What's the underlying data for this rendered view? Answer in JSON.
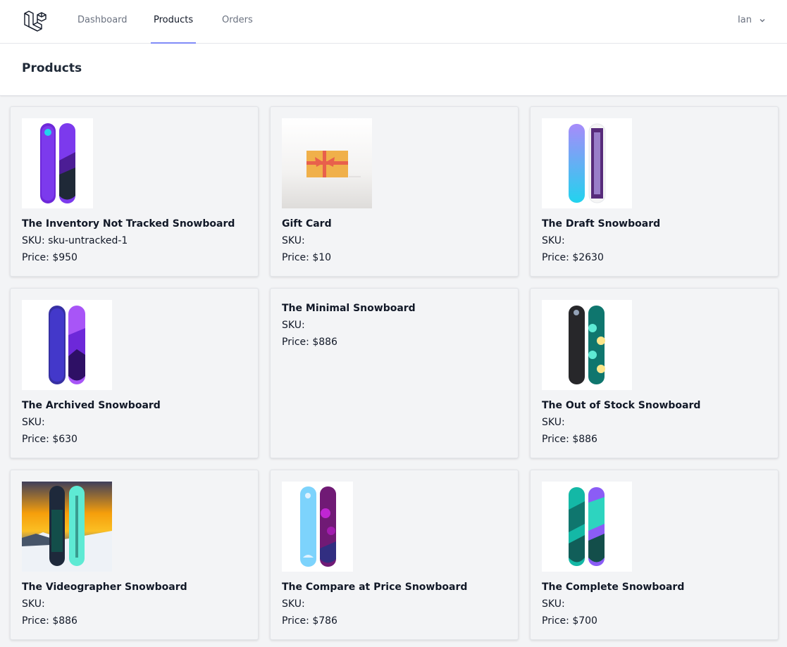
{
  "nav": {
    "links": [
      "Dashboard",
      "Products",
      "Orders"
    ],
    "active": "Products",
    "user": "Ian"
  },
  "header": {
    "title": "Products"
  },
  "products": [
    {
      "name": "The Inventory Not Tracked Snowboard",
      "sku": "SKU: sku-untracked-1",
      "price": "Price: $950",
      "image": "snowboard-purple-pair"
    },
    {
      "name": "Gift Card",
      "sku": "SKU:",
      "price": "Price: $10",
      "image": "gift-card"
    },
    {
      "name": "The Draft Snowboard",
      "sku": "SKU:",
      "price": "Price: $2630",
      "image": "snowboard-hydrogen-pair"
    },
    {
      "name": "The Archived Snowboard",
      "sku": "SKU:",
      "price": "Price: $630",
      "image": "snowboard-blue-purple-pair"
    },
    {
      "name": "The Minimal Snowboard",
      "sku": "SKU:",
      "price": "Price: $886",
      "image": ""
    },
    {
      "name": "The Out of Stock Snowboard",
      "sku": "SKU:",
      "price": "Price: $886",
      "image": "snowboard-black-teal-pair"
    },
    {
      "name": "The Videographer Snowboard",
      "sku": "SKU:",
      "price": "Price: $886",
      "image": "snowboard-sunset-photo"
    },
    {
      "name": "The Compare at Price Snowboard",
      "sku": "SKU:",
      "price": "Price: $786",
      "image": "snowboard-sky-magenta-pair"
    },
    {
      "name": "The Complete Snowboard",
      "sku": "SKU:",
      "price": "Price: $700",
      "image": "snowboard-shred-pair"
    }
  ],
  "colors": {
    "accent": "#818cf8",
    "background": "#f3f4f6"
  }
}
